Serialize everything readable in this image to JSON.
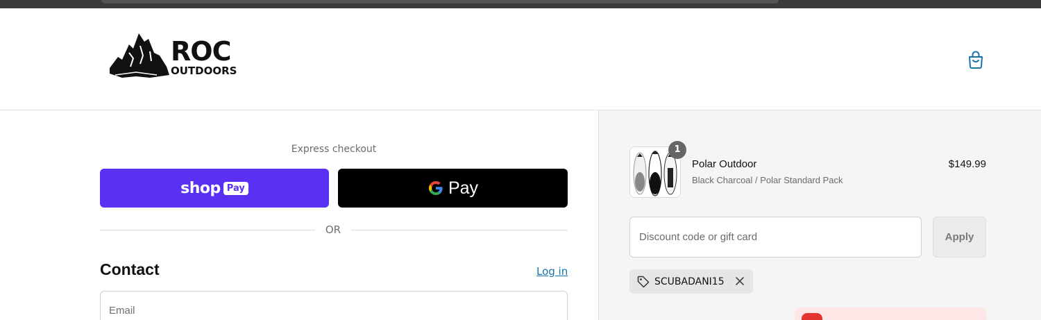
{
  "header": {
    "brand_name": "ROC",
    "brand_sub": "OUTDOORS",
    "cart_icon": "shopping-bag-icon"
  },
  "express": {
    "label": "Express checkout",
    "shop_pay_text": "shop",
    "shop_pay_badge": "Pay",
    "google_pay_text": "Pay"
  },
  "divider": {
    "text": "OR"
  },
  "contact": {
    "title": "Contact",
    "login_label": "Log in",
    "email_placeholder": "Email"
  },
  "order": {
    "item": {
      "name": "Polar Outdoor",
      "variant": "Black Charcoal / Polar Standard Pack",
      "price": "$149.99",
      "quantity": "1"
    },
    "discount": {
      "placeholder": "Discount code or gift card",
      "apply_label": "Apply",
      "applied_code": "SCUBADANI15"
    }
  },
  "colors": {
    "shop_pay": "#5a31f4",
    "google_pay": "#000000",
    "link": "#1773b0",
    "summary_bg": "#f5f5f5"
  }
}
